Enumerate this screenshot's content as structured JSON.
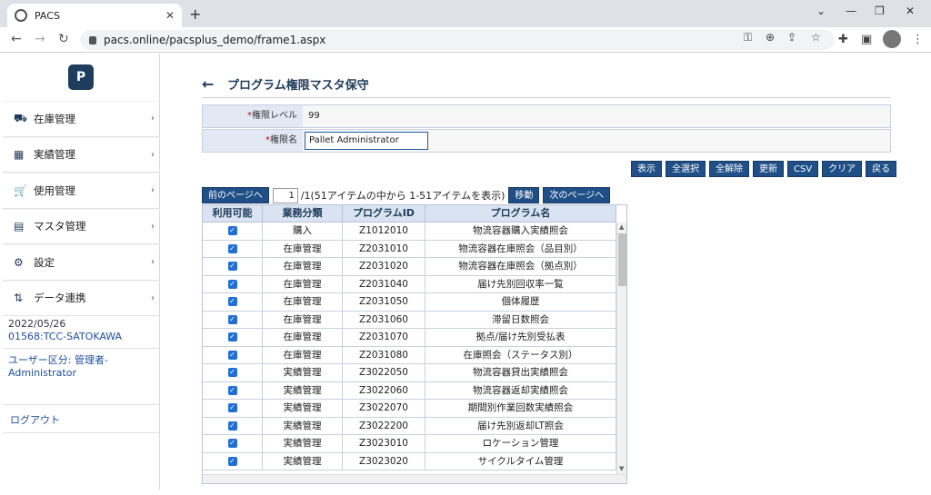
{
  "browser": {
    "tab_title": "PACS",
    "url": "pacs.online/pacsplus_demo/frame1.aspx",
    "new_tab": "+",
    "close_tab": "✕"
  },
  "sidebar": {
    "logo_text": "P",
    "items": [
      {
        "label": "在庫管理",
        "icon": "warehouse-icon"
      },
      {
        "label": "実績管理",
        "icon": "table-icon"
      },
      {
        "label": "使用管理",
        "icon": "cart-icon"
      },
      {
        "label": "マスタ管理",
        "icon": "document-icon"
      },
      {
        "label": "設定",
        "icon": "gear-icon"
      },
      {
        "label": "データ連携",
        "icon": "sync-icon"
      }
    ],
    "date": "2022/05/26",
    "user_code": "01568:TCC-SATOKAWA",
    "user_type": "ユーザー区分: 管理者-Administrator",
    "logout": "ログアウト"
  },
  "main": {
    "title": "プログラム権限マスタ保守",
    "fields": {
      "level_label": "権限レベル",
      "level_value": "99",
      "name_label": "権限名",
      "name_value": "Pallet Administrator"
    },
    "buttons": [
      "表示",
      "全選択",
      "全解除",
      "更新",
      "CSV",
      "クリア",
      "戻る"
    ],
    "pager": {
      "prev": "前のページへ",
      "page": "1",
      "info": "/1(51アイテムの中から 1-51アイテムを表示)",
      "move": "移動",
      "next": "次のページへ"
    },
    "table": {
      "headers": [
        "利用可能",
        "業務分類",
        "プログラムID",
        "プログラム名"
      ],
      "rows": [
        {
          "category": "購入",
          "id": "Z1012010",
          "name": "物流容器購入実績照会"
        },
        {
          "category": "在庫管理",
          "id": "Z2031010",
          "name": "物流容器在庫照会（品目別）"
        },
        {
          "category": "在庫管理",
          "id": "Z2031020",
          "name": "物流容器在庫照会（拠点別）"
        },
        {
          "category": "在庫管理",
          "id": "Z2031040",
          "name": "届け先別回収率一覧"
        },
        {
          "category": "在庫管理",
          "id": "Z2031050",
          "name": "個体履歴"
        },
        {
          "category": "在庫管理",
          "id": "Z2031060",
          "name": "滞留日数照会"
        },
        {
          "category": "在庫管理",
          "id": "Z2031070",
          "name": "拠点/届け先別受払表"
        },
        {
          "category": "在庫管理",
          "id": "Z2031080",
          "name": "在庫照会（ステータス別）"
        },
        {
          "category": "実績管理",
          "id": "Z3022050",
          "name": "物流容器貸出実績照会"
        },
        {
          "category": "実績管理",
          "id": "Z3022060",
          "name": "物流容器返却実績照会"
        },
        {
          "category": "実績管理",
          "id": "Z3022070",
          "name": "期間別作業回数実績照会"
        },
        {
          "category": "実績管理",
          "id": "Z3022200",
          "name": "届け先別返却LT照会"
        },
        {
          "category": "実績管理",
          "id": "Z3023010",
          "name": "ロケーション管理"
        },
        {
          "category": "実績管理",
          "id": "Z3023020",
          "name": "サイクルタイム管理"
        }
      ]
    }
  }
}
